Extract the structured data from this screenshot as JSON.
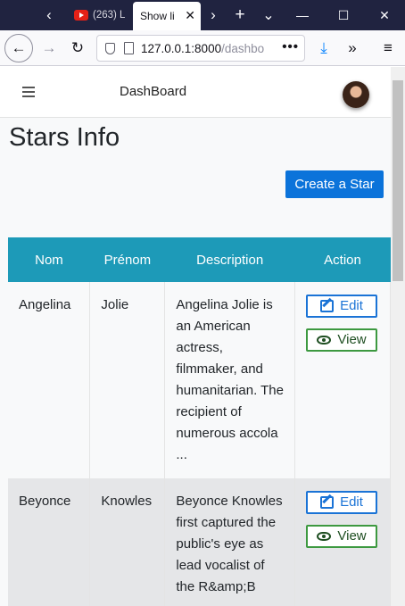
{
  "browser": {
    "tabs": [
      {
        "title": "(263) L",
        "active": false
      },
      {
        "title": "Show li",
        "active": true
      }
    ],
    "url_host": "127.0.0.1:8000",
    "url_path": "/dashbo",
    "new_tab_glyph": "+",
    "tab_list_glyph": "⌄"
  },
  "app": {
    "brand": "DashBoard",
    "page_title": "Stars Info",
    "create_label": "Create a Star",
    "columns": [
      "Nom",
      "Prénom",
      "Description",
      "Action"
    ],
    "rows": [
      {
        "nom": "Angelina",
        "prenom": "Jolie",
        "description": "Angelina Jolie is an American actress, filmmaker, and humanitarian. The recipient of numerous accola ...",
        "edit_label": "Edit",
        "view_label": "View"
      },
      {
        "nom": "Beyonce",
        "prenom": "Knowles",
        "description": "Beyonce Knowles first captured the public's eye as lead vocalist of the R&amp;B",
        "edit_label": "Edit",
        "view_label": "View"
      }
    ]
  },
  "colors": {
    "table_header": "#1d9ab8",
    "primary_button": "#0b73da",
    "edit_outline": "#1a73d6",
    "view_outline": "#3d9940",
    "browser_tabbar": "#202340"
  }
}
